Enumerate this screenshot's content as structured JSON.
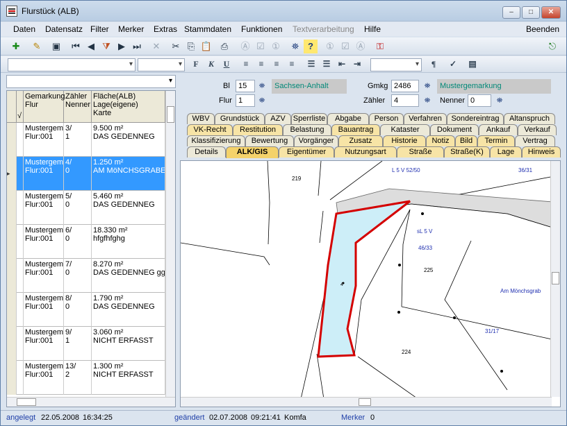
{
  "window": {
    "title": "Flurstück (ALB)",
    "minimize": "–",
    "maximize": "□",
    "close": "✕"
  },
  "menu": {
    "items": [
      "Daten",
      "Datensatz",
      "Filter",
      "Merker",
      "Extras",
      "Stammdaten",
      "Funktionen",
      "Textverarbeitung",
      "Hilfe"
    ],
    "right": "Beenden",
    "disabled": "Textverarbeitung"
  },
  "toolbar": {
    "icons": [
      "add-record-icon",
      "edit-icon",
      "copy-record-icon",
      "first-icon",
      "prev-icon",
      "filter-icon",
      "next-icon",
      "last-icon",
      "delete-icon",
      "cut-icon",
      "copy-icon",
      "paste-icon",
      "print-icon",
      "box-a-icon",
      "check-icon",
      "box-1-icon",
      "binoculars-icon",
      "help-icon",
      "box-1b-icon",
      "check-b-icon",
      "box-a-b-icon",
      "key-icon",
      "exit-icon"
    ]
  },
  "grid": {
    "headers": [
      {
        "col1": "Gemarkung\nFlur",
        "col2": "Zähler\nNenner",
        "col3": "Fläche(ALB)\nLage(eigene)\nKarte"
      }
    ],
    "check_header": "√",
    "rows": [
      {
        "c1": "Mustergema\nFlur:001",
        "c2": "3/\n1",
        "c3": "9.500 m²\nDAS GEDENNEG",
        "selected": false
      },
      {
        "c1": "Mustergema\nFlur:001",
        "c2": "4/\n0",
        "c3": "1.250 m²\nAM MöNCHSGRABE",
        "selected": true
      },
      {
        "c1": "Mustergema\nFlur:001",
        "c2": "5/\n0",
        "c3": "5.460 m²\nDAS GEDENNEG",
        "selected": false
      },
      {
        "c1": "Mustergema\nFlur:001",
        "c2": "6/\n0",
        "c3": "18.330 m²\nhfgfhfghg",
        "selected": false
      },
      {
        "c1": "Mustergema\nFlur:001",
        "c2": "7/\n0",
        "c3": "8.270 m²\nDAS GEDENNEG ggh",
        "selected": false
      },
      {
        "c1": "Mustergema\nFlur:001",
        "c2": "8/\n0",
        "c3": "1.790 m²\nDAS GEDENNEG",
        "selected": false
      },
      {
        "c1": "Mustergema\nFlur:001",
        "c2": "9/\n1",
        "c3": "3.060 m²\nNICHT ERFASST",
        "selected": false
      },
      {
        "c1": "Mustergema\nFlur:001",
        "c2": "13/\n2",
        "c3": "1.300 m²\nNICHT ERFASST",
        "selected": false
      }
    ]
  },
  "header": {
    "bl_label": "Bl",
    "bl_value": "15",
    "bl_name": "Sachsen-Anhalt",
    "flur_label": "Flur",
    "flur_value": "1",
    "gmkg_label": "Gmkg",
    "gmkg_value": "2486",
    "gmkg_name": "Mustergemarkung",
    "zaehler_label": "Zähler",
    "zaehler_value": "4",
    "nenner_label": "Nenner",
    "nenner_value": "0"
  },
  "tabs": {
    "row1": [
      "WBV",
      "Grundstück",
      "AZV",
      "Sperrliste",
      "Abgabe",
      "Person",
      "Verfahren",
      "Sondereintrag",
      "Altanspruch"
    ],
    "row2": [
      "VK-Recht",
      "Restitution",
      "Belastung",
      "Bauantrag",
      "Kataster",
      "Dokument",
      "Ankauf",
      "Verkauf"
    ],
    "row3": [
      "Klassifizierung",
      "Bewertung",
      "Vorgänger",
      "Zusatz",
      "Historie",
      "Notiz",
      "Bild",
      "Termin",
      "Vertrag"
    ],
    "row4": [
      "Details",
      "ALK/GIS",
      "Eigentümer",
      "Nutzungsart",
      "Straße",
      "Straße(K)",
      "Lage",
      "Hinweis"
    ],
    "active": "ALK/GIS"
  },
  "map": {
    "labels": [
      "219",
      "L 5 V 52/50",
      "36/31",
      "sL 5 V",
      "46/33",
      "225",
      "4",
      "Am Mönchsgrab",
      "31/17",
      "224"
    ],
    "highlight_color": "#d40000",
    "fill_color": "#cdeef8"
  },
  "status": {
    "created_label": "angelegt",
    "created_date": "22.05.2008",
    "created_time": "16:34:25",
    "changed_label": "geändert",
    "changed_date": "02.07.2008",
    "changed_time": "09:21:41",
    "changed_user": "Komfa",
    "merker_label": "Merker",
    "merker_value": "0"
  }
}
